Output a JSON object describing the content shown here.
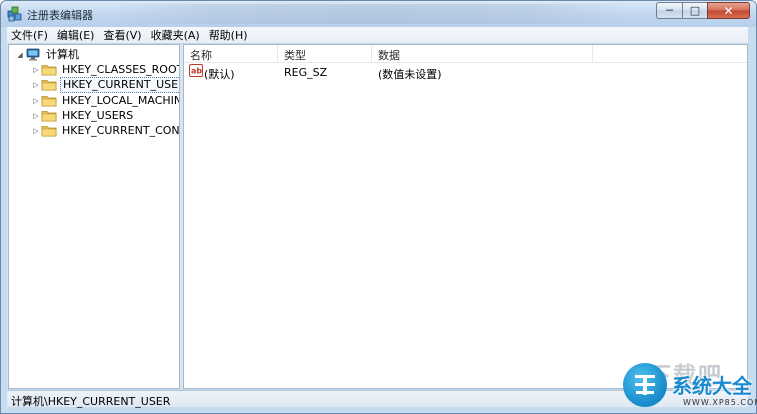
{
  "window": {
    "title": "注册表编辑器",
    "minimize_glyph": "─",
    "maximize_glyph": "□",
    "close_glyph": "✕"
  },
  "menu": [
    {
      "label": "文件(F)"
    },
    {
      "label": "编辑(E)"
    },
    {
      "label": "查看(V)"
    },
    {
      "label": "收藏夹(A)"
    },
    {
      "label": "帮助(H)"
    }
  ],
  "tree": {
    "root": {
      "label": "计算机",
      "expander": "◢",
      "icon": "computer-icon"
    },
    "children": [
      {
        "label": "HKEY_CLASSES_ROOT",
        "expander": "▷",
        "icon": "folder-icon",
        "selected": false
      },
      {
        "label": "HKEY_CURRENT_USER",
        "expander": "▷",
        "icon": "folder-icon",
        "selected": true
      },
      {
        "label": "HKEY_LOCAL_MACHINE",
        "expander": "▷",
        "icon": "folder-icon",
        "selected": false
      },
      {
        "label": "HKEY_USERS",
        "expander": "▷",
        "icon": "folder-icon",
        "selected": false
      },
      {
        "label": "HKEY_CURRENT_CONFIG",
        "expander": "▷",
        "icon": "folder-icon",
        "selected": false
      }
    ]
  },
  "list": {
    "columns": [
      {
        "label": "名称"
      },
      {
        "label": "类型"
      },
      {
        "label": "数据"
      }
    ],
    "rows": [
      {
        "icon": "string-value-icon",
        "name": "(默认)",
        "type": "REG_SZ",
        "data": "(数值未设置)"
      }
    ]
  },
  "status": {
    "path": "计算机\\HKEY_CURRENT_USER"
  },
  "watermark": {
    "brand": "系统大全",
    "url": "WWW.XP85.COM",
    "faint_text": "下载吧"
  },
  "colors": {
    "title_bar": "#c4d8ef",
    "close_button": "#c2482f",
    "folder": "#e8c25a",
    "logo_blue": "#1a8ad0"
  }
}
